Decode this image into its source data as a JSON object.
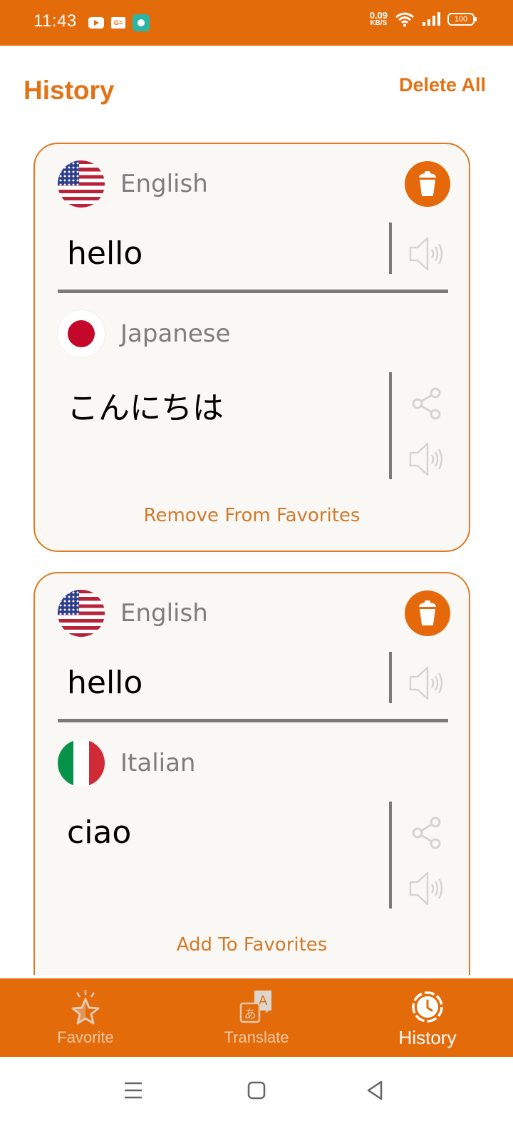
{
  "status_bar": {
    "time": "11:43",
    "app_icons": [
      "youtube-icon",
      "news-icon",
      "app-icon"
    ],
    "net_speed_value": "0.09",
    "net_speed_unit": "KB/S",
    "battery": "100"
  },
  "header": {
    "title": "History",
    "delete_all_label": "Delete All"
  },
  "history": [
    {
      "source": {
        "language": "English",
        "flag": "us-flag",
        "text": "hello"
      },
      "target": {
        "language": "Japanese",
        "flag": "japan-flag",
        "text": "こんにちは"
      },
      "favorite_action": "Remove From Favorites"
    },
    {
      "source": {
        "language": "English",
        "flag": "us-flag",
        "text": "hello"
      },
      "target": {
        "language": "Italian",
        "flag": "italy-flag",
        "text": "ciao"
      },
      "favorite_action": "Add To Favorites"
    }
  ],
  "bottom_nav": {
    "items": [
      {
        "label": "Favorite",
        "icon": "star-icon",
        "active": false
      },
      {
        "label": "Translate",
        "icon": "translate-icon",
        "active": false
      },
      {
        "label": "History",
        "icon": "clock-icon",
        "active": true
      }
    ]
  },
  "colors": {
    "accent": "#e36b0a",
    "link": "#d27a2c",
    "card_background": "#f9f8f5",
    "language_label": "#7d7d7d"
  }
}
